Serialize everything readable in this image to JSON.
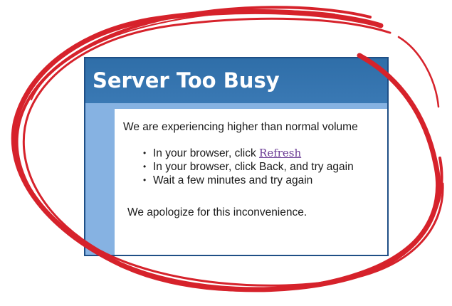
{
  "page": {
    "title": "Server Too Busy",
    "intro": "We are experiencing higher than normal volume",
    "bullets": [
      {
        "prefix": "In your browser, click ",
        "link": "Refresh"
      },
      {
        "prefix": "In your browser, click Back, and try again"
      },
      {
        "prefix": "Wait a few minutes and try again"
      }
    ],
    "apology": "We apologize for this inconvenience.",
    "bullet_glyph": "•"
  },
  "colors": {
    "header": "#2f6ea8",
    "sidebar": "#86b2e2",
    "link": "#6a3a94",
    "scribble": "#d6222b"
  },
  "decoration": {
    "overlay": "red hand-drawn circle"
  }
}
